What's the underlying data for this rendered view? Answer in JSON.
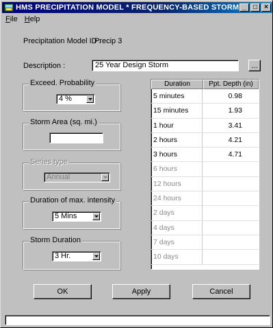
{
  "window": {
    "title": "HMS PRECIPITATION MODEL * FREQUENCY-BASED STORM",
    "buttons": [
      "_",
      "□",
      "×"
    ]
  },
  "menu": [
    {
      "label_rest": "ile",
      "key": "F"
    },
    {
      "label_rest": "elp",
      "key": "H"
    }
  ],
  "model_id": {
    "label": "Precipitation Model ID :",
    "value": "Precip 3"
  },
  "description": {
    "label": "Description :",
    "value": "25 Year Design Storm",
    "browse_label": "..."
  },
  "exceed_probability": {
    "label": "Exceed. Probability",
    "value": "4 %"
  },
  "storm_area": {
    "label": "Storm Area (sq. mi.)",
    "value": ""
  },
  "series_type": {
    "label": "Series type",
    "value": "Annual"
  },
  "duration_max_intensity": {
    "label": "Duration of max. intensity",
    "value": "5 Mins"
  },
  "storm_duration": {
    "label": "Storm Duration",
    "value": "3 Hr."
  },
  "depth_table": {
    "headers": [
      "Duration",
      "Ppt. Depth (in)"
    ],
    "rows": [
      {
        "duration": "5 minutes",
        "depth": "0.98",
        "active": true
      },
      {
        "duration": "15 minutes",
        "depth": "1.93",
        "active": true
      },
      {
        "duration": "1 hour",
        "depth": "3.41",
        "active": true
      },
      {
        "duration": "2 hours",
        "depth": "4.21",
        "active": true
      },
      {
        "duration": "3 hours",
        "depth": "4.71",
        "active": true
      },
      {
        "duration": "6 hours",
        "depth": "",
        "active": false
      },
      {
        "duration": "12 hours",
        "depth": "",
        "active": false
      },
      {
        "duration": "24 hours",
        "depth": "",
        "active": false
      },
      {
        "duration": "2 days",
        "depth": "",
        "active": false
      },
      {
        "duration": "4 days",
        "depth": "",
        "active": false
      },
      {
        "duration": "7 days",
        "depth": "",
        "active": false
      },
      {
        "duration": "10 days",
        "depth": "",
        "active": false
      }
    ]
  },
  "actions": {
    "ok": "OK",
    "apply": "Apply",
    "cancel": "Cancel"
  },
  "status": {
    "text": ""
  }
}
